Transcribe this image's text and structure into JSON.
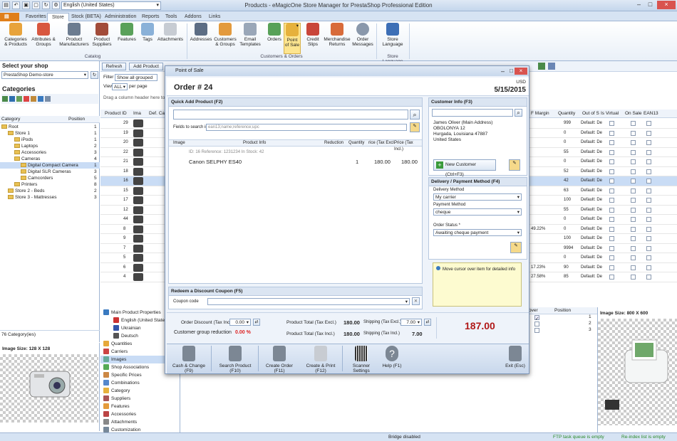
{
  "window": {
    "title": "Products - eMagicOne Store Manager for PrestaShop Professional Edition",
    "language": "English (United States)"
  },
  "tabs": [
    "Favorites",
    "Store",
    "Stock (BETA)",
    "Administration",
    "Reports",
    "Tools",
    "Addons",
    "Links"
  ],
  "ribbon": {
    "catalog": [
      "Categories & Products",
      "Attributes & Groups",
      "Product Manufacturers",
      "Product Suppliers",
      "Features",
      "Tags",
      "Attachments"
    ],
    "catalog_label": "Catalog",
    "customers": [
      "Addresses",
      "Customers & Groups",
      "Email Templates",
      "Orders",
      "Point of Sale",
      "Credit Slips",
      "Merchandise Returns",
      "Order Messages"
    ],
    "customers_label": "Customers & Orders",
    "language": [
      "Store Language"
    ],
    "language_label": "Store Language"
  },
  "left": {
    "select_shop": "Select your shop",
    "shop": "PrestaShop Demo-store",
    "categories": "Categories",
    "col_category": "Category",
    "col_position": "Position",
    "tree": [
      {
        "name": "Root",
        "pos": "1",
        "lvl": 0
      },
      {
        "name": "Store 1",
        "pos": "1",
        "lvl": 1
      },
      {
        "name": "iPods",
        "pos": "1",
        "lvl": 2
      },
      {
        "name": "Laptops",
        "pos": "2",
        "lvl": 2
      },
      {
        "name": "Accessories",
        "pos": "3",
        "lvl": 2
      },
      {
        "name": "Cameras",
        "pos": "4",
        "lvl": 2
      },
      {
        "name": "Digital Compact Camera",
        "pos": "1",
        "lvl": 3
      },
      {
        "name": "Digital SLR Cameras",
        "pos": "3",
        "lvl": 3
      },
      {
        "name": "Camcorders",
        "pos": "5",
        "lvl": 3
      },
      {
        "name": "Printers",
        "pos": "8",
        "lvl": 2
      },
      {
        "name": "Store 2 - Beds",
        "pos": "2",
        "lvl": 1
      },
      {
        "name": "Store 3 - Mattresses",
        "pos": "3",
        "lvl": 1
      }
    ],
    "count": "76 Category(ies)",
    "image_size": "Image Size: 128 X 128"
  },
  "grid_toolbar": {
    "refresh": "Refresh",
    "add": "Add Product",
    "filter": "Filter",
    "filter_value": "Show all grouped",
    "view": "View",
    "view_value": "ALL",
    "per_page": "per page",
    "group_hint": "Drag a column header here to grou"
  },
  "grid": {
    "cols_left": [
      "Product ID",
      "Ima",
      "Def. Ca"
    ],
    "cols_right": [
      "F Margin",
      "Quantity",
      "Out of S",
      "Is Virtual",
      "On Sale",
      "EAN13"
    ],
    "ids": [
      "29",
      "19",
      "20",
      "22",
      "21",
      "18",
      "16",
      "15",
      "17",
      "12",
      "44",
      "8",
      "9",
      "7",
      "5",
      "6",
      "4"
    ],
    "qty": [
      "999",
      "0",
      "0",
      "55",
      "0",
      "52",
      "42",
      "63",
      "100",
      "55",
      "0",
      "0",
      "100",
      "9994",
      "0",
      "90",
      "85"
    ],
    "margin": [
      "",
      "",
      "",
      "",
      "",
      "",
      "",
      "",
      "",
      "",
      "",
      "49.22%",
      "",
      "",
      "",
      "17.23%",
      "27.58%"
    ],
    "outofstock": "Default: De"
  },
  "pos": {
    "title": "Point of Sale",
    "order": "Order # 24",
    "currency": "USD",
    "date": "5/15/2015",
    "quick_add": "Quick Add Product (F2)",
    "fields_label": "Fields to search in",
    "fields_value": "ean13;name;reference;upc",
    "headers": [
      "Image",
      "Product Info",
      "Reduction",
      "Quantity",
      "rice (Tax Excl.",
      "Price (Tax Incl.)"
    ],
    "item_meta": "ID: 16 Reference: 1231234 In Stock: 42",
    "item_name": "Canon SELPHY ES40",
    "item_qty": "1",
    "item_price_excl": "180.00",
    "item_price_incl": "180.00",
    "coupon_title": "Redeem a Discount Coupon (F5)",
    "coupon_label": "Coupon code",
    "customer_title": "Customer Info (F3)",
    "customer_addr": [
      "James Oliver (Main Address)",
      "OBOLONYA 12",
      "Hurgada, Louisiana 47887",
      "United States"
    ],
    "new_customer": "New Customer (Ctrl+F3)",
    "delivery_title": "Delivery / Payment Method (F4)",
    "delivery_label": "Delivery Method",
    "delivery_value": "My carrier",
    "payment_label": "Payment Method",
    "payment_value": "cheque",
    "status_label": "Order Status *",
    "status_value": "Awaiting cheque payment",
    "hint": "Move cursor over item for detailed info",
    "order_discount_label": "Order Discount (Tax Incl.)",
    "order_discount": "0.00",
    "group_reduction_label": "Customer group reduction",
    "group_reduction": "0.00 %",
    "pt_excl_label": "Product Total (Tax Excl.)",
    "pt_excl": "180.00",
    "pt_incl_label": "Product Total (Tax Incl.)",
    "pt_incl": "180.00",
    "ship_excl_label": "Shipping (Tax Excl.)",
    "ship_excl": "7.00",
    "ship_incl_label": "Shipping (Tax Incl.)",
    "ship_incl": "7.00",
    "total": "187.00",
    "buttons": [
      "Cash & Change (F9)",
      "Search Product (F10)",
      "Create Order (F11)",
      "Create & Print (F12)",
      "Scanner Settings",
      "Help (F1)",
      "Exit (Esc)"
    ]
  },
  "props": [
    "Main Product Properties",
    "English (United States)",
    "Ukrainian",
    "Deutsch",
    "Quantities",
    "Carriers",
    "Images",
    "Shop Associations",
    "Specific Prices",
    "Combinations",
    "Category",
    "Suppliers",
    "Features",
    "Accessories",
    "Attachments",
    "Customization"
  ],
  "right": {
    "image_size": "Image Size: 800 X 600",
    "col_over": "over",
    "col_position": "Position",
    "positions": [
      "1",
      "2",
      "3"
    ]
  },
  "status": {
    "bridge": "Bridge disabled",
    "ftp": "FTP task queue is empty",
    "reindex": "Re-index list is empty"
  }
}
